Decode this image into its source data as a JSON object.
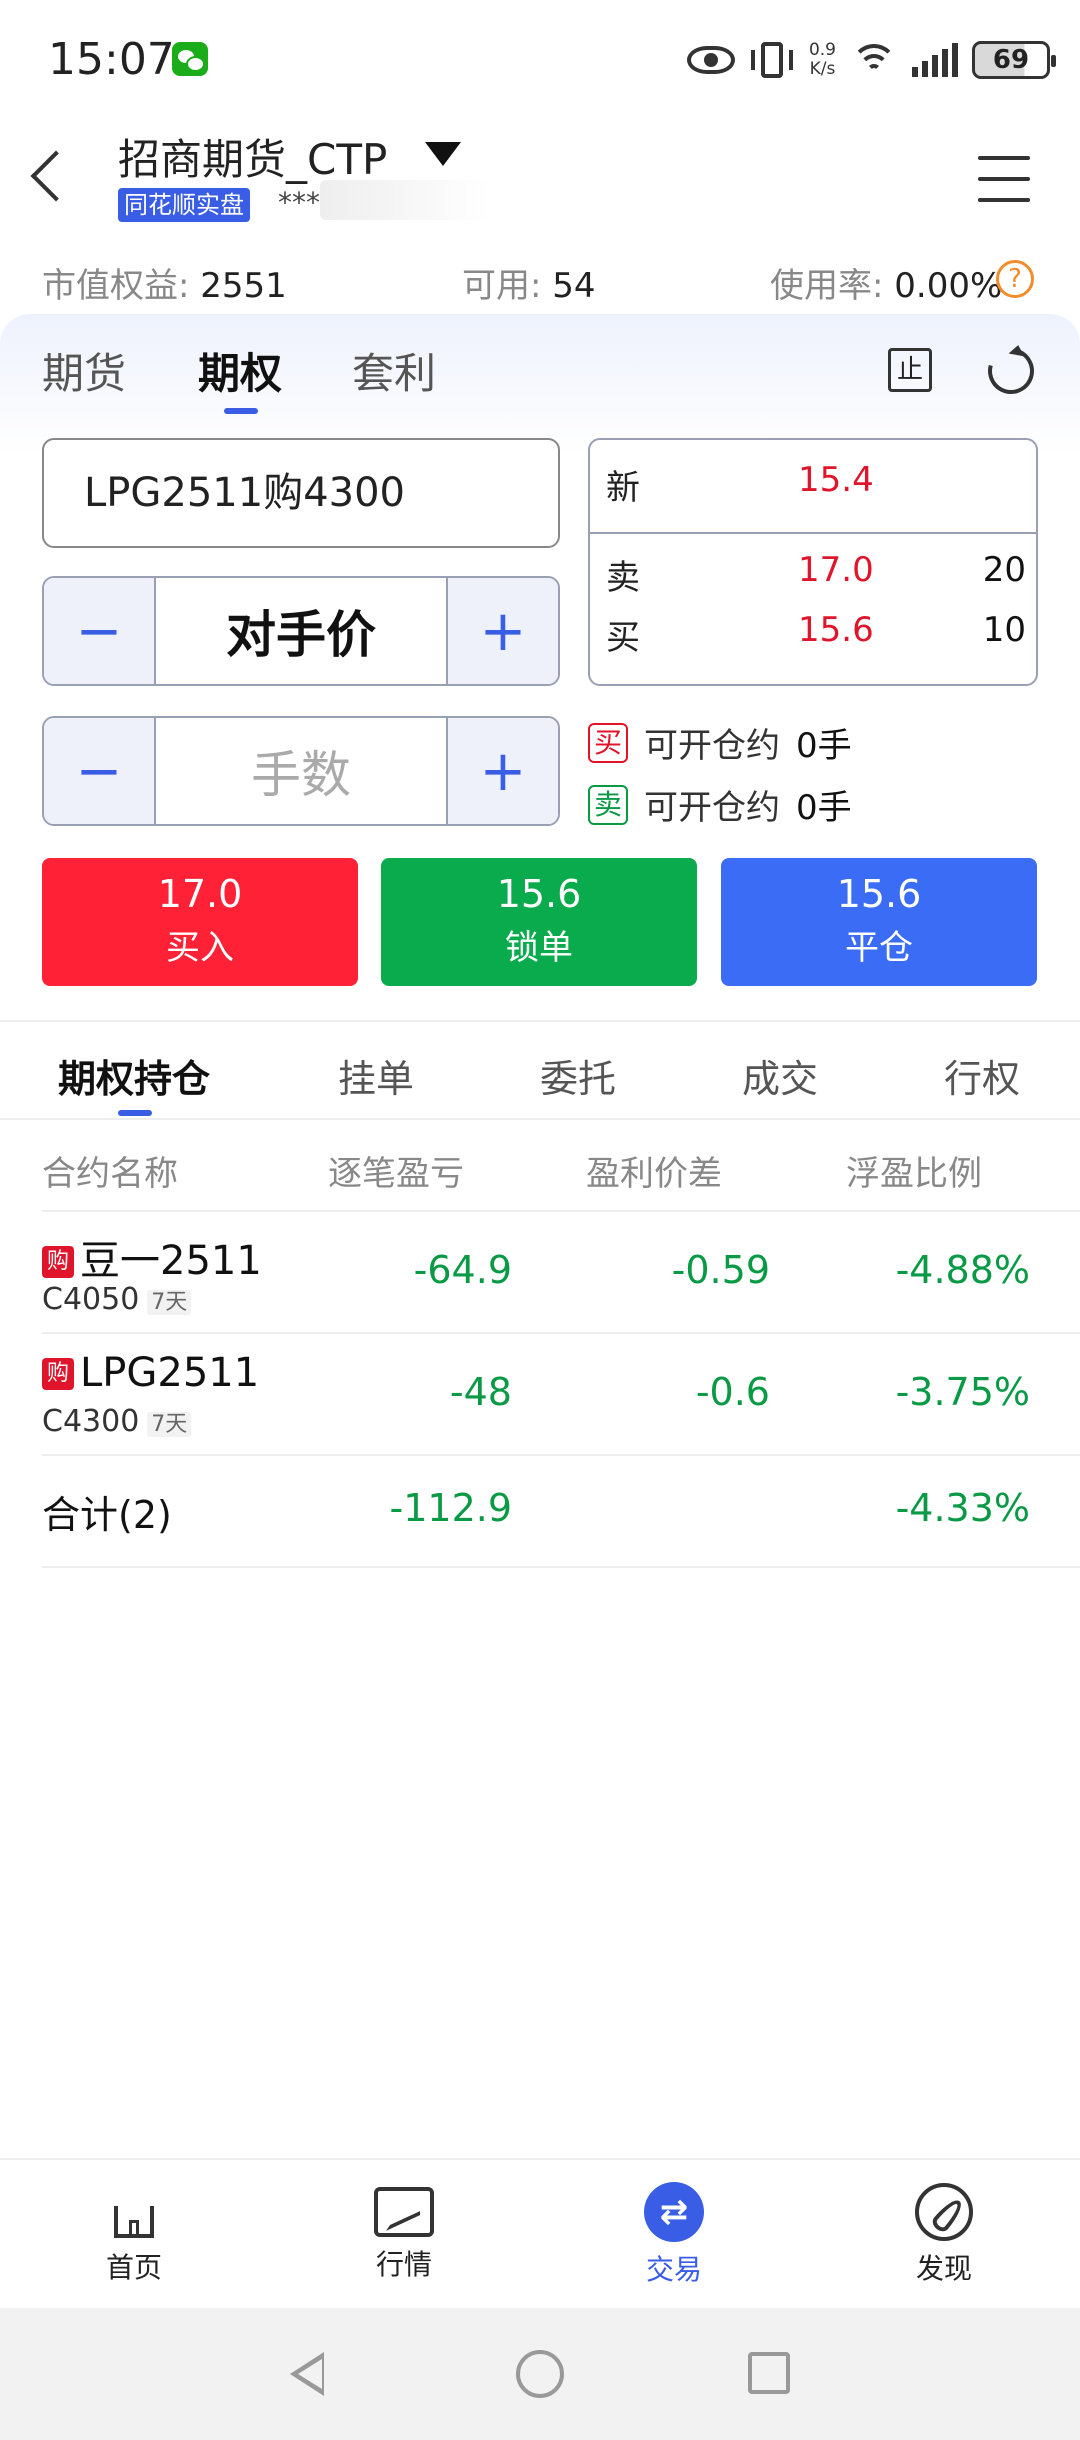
{
  "status_bar": {
    "time": "15:07",
    "speed_value": "0.9",
    "speed_unit": "K/s",
    "battery": "69"
  },
  "header": {
    "title": "招商期货_CTP",
    "badge": "同花顺实盘",
    "account_masked": "***"
  },
  "summary": {
    "equity_label": "市值权益:",
    "equity_value": "2551",
    "available_label": "可用:",
    "available_value": "54",
    "usage_label": "使用率:",
    "usage_value": "0.00%",
    "help_icon": "?"
  },
  "tabs": [
    "期货",
    "期权",
    "套利"
  ],
  "active_tab": "期权",
  "toolbar": {
    "stop_label": "止"
  },
  "order": {
    "contract": "LPG2511购4300",
    "price_mode": "对手价",
    "qty_placeholder": "手数",
    "minus": "−",
    "plus": "+"
  },
  "quote": {
    "last_label": "新",
    "last_price": "15.4",
    "ask_label": "卖",
    "ask_price": "17.0",
    "ask_vol": "20",
    "bid_label": "买",
    "bid_price": "15.6",
    "bid_vol": "10"
  },
  "open_avail": {
    "buy_tag": "买",
    "buy_text": "可开仓约",
    "buy_num": "0手",
    "sell_tag": "卖",
    "sell_text": "可开仓约",
    "sell_num": "0手"
  },
  "actions": [
    {
      "price": "17.0",
      "label": "买入",
      "color": "#ff2136"
    },
    {
      "price": "15.6",
      "label": "锁单",
      "color": "#0aab4c"
    },
    {
      "price": "15.6",
      "label": "平仓",
      "color": "#3a6cf6"
    }
  ],
  "position_tabs": [
    "期权持仓",
    "挂单",
    "委托",
    "成交",
    "行权"
  ],
  "table": {
    "headers": [
      "合约名称",
      "逐笔盈亏",
      "盈利价差",
      "浮盈比例"
    ],
    "rows": [
      {
        "badge": "购",
        "name": "豆一2511",
        "sub": "C4050",
        "days": "7天",
        "pnl": "-64.9",
        "spread": "-0.59",
        "ratio": "-4.88%"
      },
      {
        "badge": "购",
        "name": "LPG2511",
        "sub": "C4300",
        "days": "7天",
        "pnl": "-48",
        "spread": "-0.6",
        "ratio": "-3.75%"
      }
    ],
    "total": {
      "label": "合计(2)",
      "pnl": "-112.9",
      "ratio": "-4.33%"
    }
  },
  "bottom_nav": [
    {
      "label": "首页",
      "icon": "home-icon"
    },
    {
      "label": "行情",
      "icon": "chart-icon"
    },
    {
      "label": "交易",
      "icon": "trade-icon"
    },
    {
      "label": "发现",
      "icon": "compass-icon"
    }
  ],
  "colors": {
    "accent": "#3a5de6",
    "red": "#e0142a",
    "green": "#0a9a45"
  }
}
